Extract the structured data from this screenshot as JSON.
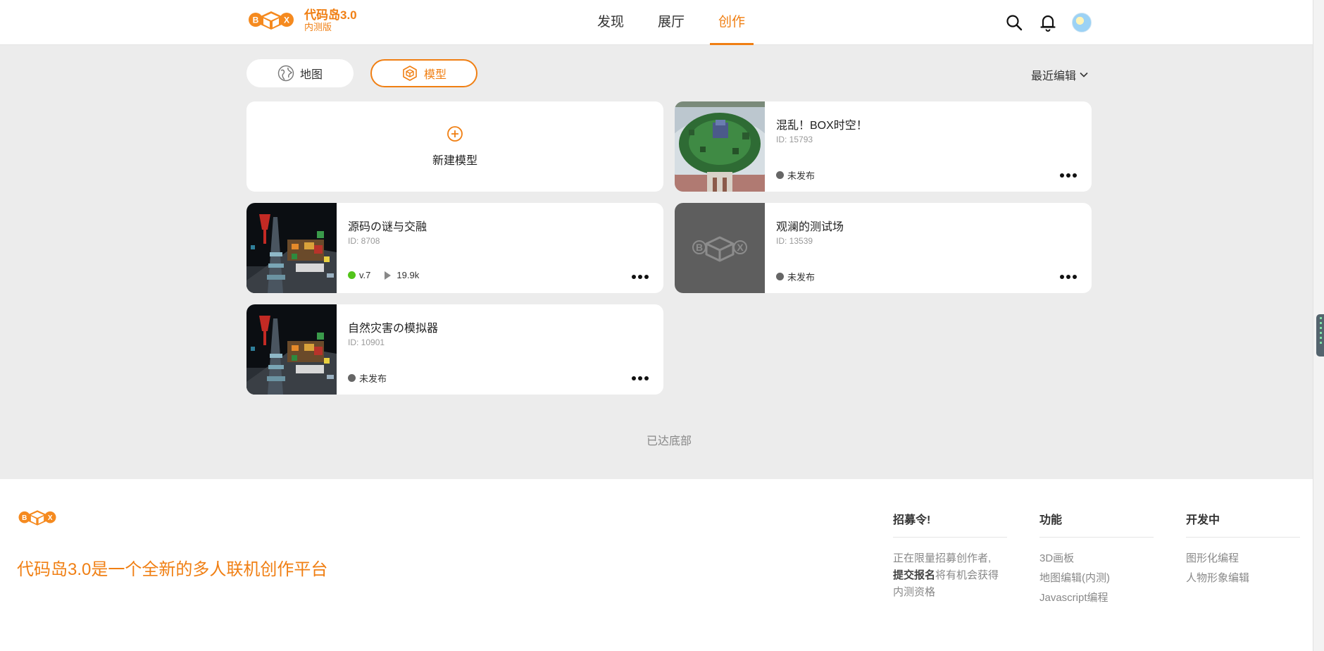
{
  "header": {
    "brand": "代码岛3.0",
    "brand_sub": "内测版",
    "nav": [
      "发现",
      "展厅",
      "创作"
    ],
    "active_nav": "创作"
  },
  "filters": {
    "map_label": "地图",
    "model_label": "模型",
    "sort_label": "最近编辑"
  },
  "new_model_label": "新建模型",
  "cards": [
    {
      "title": "混乱！BOX时空！",
      "id": "ID: 15793",
      "status": "未发布"
    },
    {
      "title": "源码の谜与交融",
      "id": "ID: 8708",
      "version": "v.7",
      "plays": "19.9k"
    },
    {
      "title": "观澜的测试场",
      "id": "ID: 13539",
      "status": "未发布"
    },
    {
      "title": "自然灾害の模拟器",
      "id": "ID: 10901",
      "status": "未发布"
    }
  ],
  "end_text": "已达底部",
  "footer": {
    "tagline": "代码岛3.0是一个全新的多人联机创作平台",
    "recruit": {
      "heading": "招募令!",
      "text_a": "正在限量招募创作者,",
      "link": "提交报名",
      "text_b": "将有机会获得内测资格"
    },
    "features": {
      "heading": "功能",
      "items": [
        "3D画板",
        "地图编辑(内测)",
        "Javascript编程"
      ]
    },
    "dev": {
      "heading": "开发中",
      "items": [
        "图形化编程",
        "人物形象编辑"
      ]
    }
  },
  "colors": {
    "accent": "#f07f13",
    "background": "#ececec",
    "published": "#52c41a",
    "unpublished": "#666666"
  }
}
